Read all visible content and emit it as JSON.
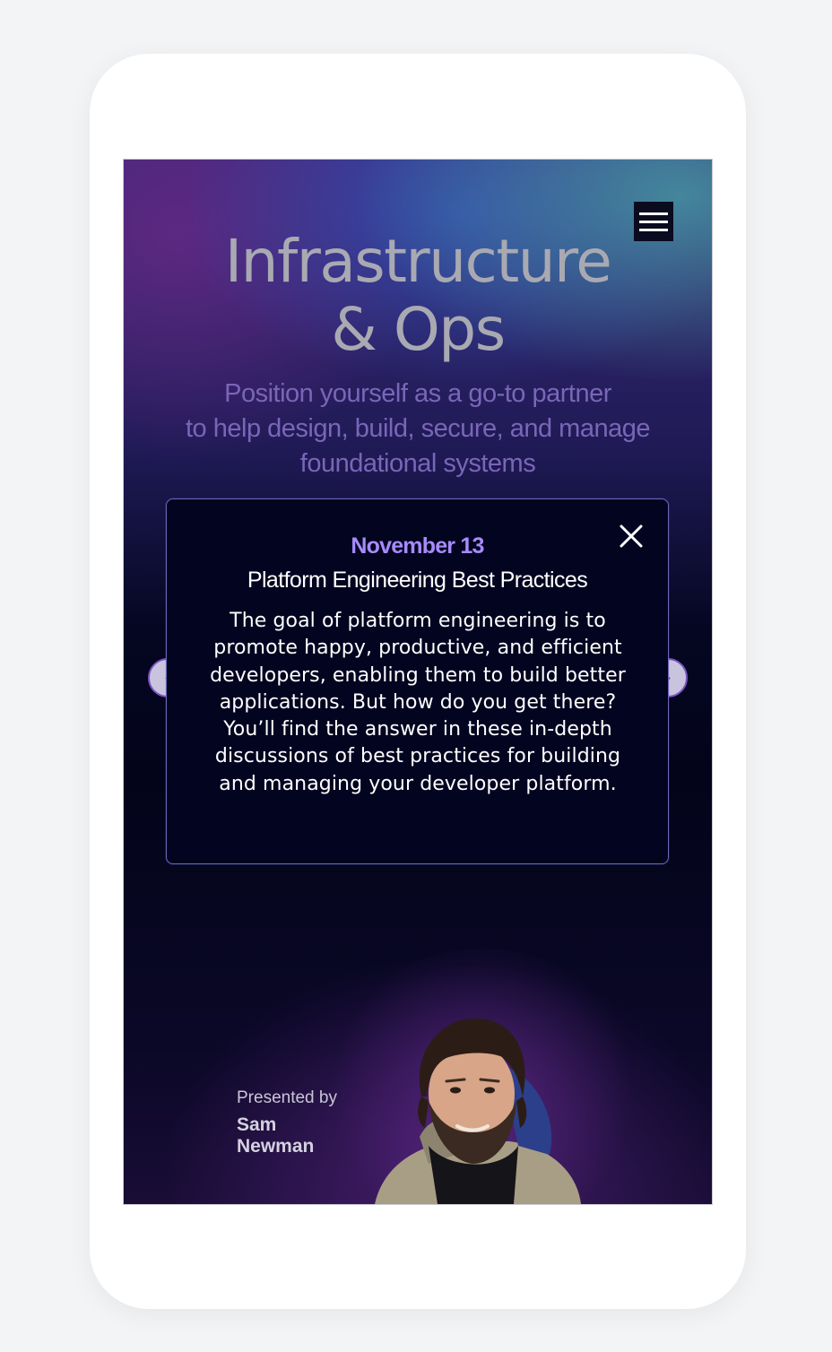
{
  "hero": {
    "title_line1": "Infrastructure",
    "title_line2": "& Ops",
    "subtitle_line1": "Position yourself as a go-to partner",
    "subtitle_line2": "to help design, build, secure, and manage",
    "subtitle_line3": "foundational systems"
  },
  "nav": {
    "menu_icon": "hamburger-menu-icon"
  },
  "carousel": {
    "prev_icon": "chevron-left-icon",
    "next_icon": "chevron-right-icon",
    "prev_glyph": "‹",
    "next_glyph": "›"
  },
  "modal": {
    "date": "November 13",
    "title": "Platform Engineering Best Practices",
    "body": "The goal of platform engineering is to promote happy, productive, and efficient developers, enabling them to build better applications. But how do you get there?  You’ll find the answer in these in-depth discussions of best practices for building and managing your developer platform.",
    "close_icon": "close-icon"
  },
  "presenter": {
    "label": "Presented by",
    "first_name": "Sam",
    "last_name": "Newman"
  },
  "colors": {
    "accent": "#a78bfa",
    "subtitle": "#7a66b8",
    "title": "#a9a9b2",
    "modal_bg": "#020420"
  }
}
